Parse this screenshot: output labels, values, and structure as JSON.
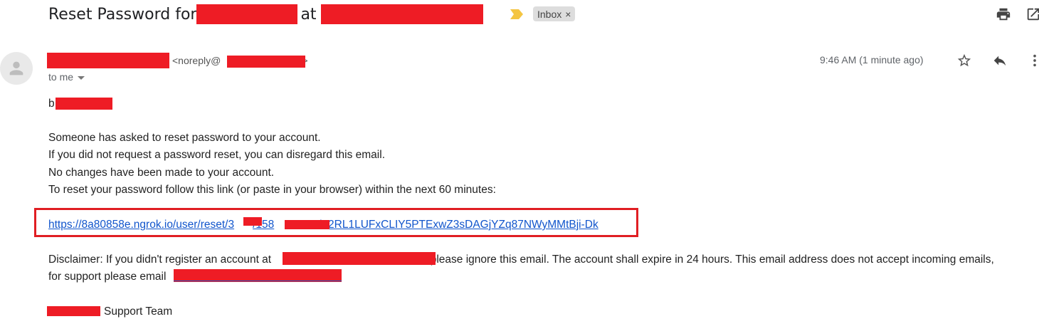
{
  "email": {
    "subject_part1": "Reset Password for",
    "subject_part2": "at",
    "label": "Inbox",
    "label_remove": "×"
  },
  "sender": {
    "email_prefix": "<noreply@",
    "email_suffix": ">",
    "recipient": "to me",
    "timestamp": "9:46 AM (1 minute ago)"
  },
  "body": {
    "greeting": "b",
    "lines": [
      "Someone has asked to reset password to your account.",
      "If you did not request a password reset, you can disregard this email.",
      "No changes have been made to your account.",
      "To reset your password follow this link (or paste in your browser) within the next 60 minutes:"
    ],
    "link": "https://8a80858e.ngrok.io/user/reset/3001/1580000000/F2RL1LUFxCLIY5PTExwZ3sDAGjYZq87NWyMMtBji-Dk",
    "link_visible_start": "https://8a80858e.ngrok.io/user/reset/3",
    "link_visible_mid": "/158",
    "link_visible_end": "/F2RL1LUFxCLIY5PTExwZ3sDAGjYZq87NWyMMtBji-Dk",
    "disclaimer_line1_start": "Disclaimer: If you didn't register an account at",
    "disclaimer_line1_end": ", please ignore this email. The account shall expire in 24 hours. This email address does not accept incoming emails,",
    "disclaimer_line2": "for support please email",
    "signoff": "Support Team"
  },
  "colors": {
    "redaction": "#ee1c25",
    "highlight_box": "#e01e23",
    "link": "#1155cc",
    "label_bg": "#dddddd",
    "importance_marker": "#f4c542"
  },
  "icons": [
    "importance-marker-icon",
    "print-icon",
    "open-in-new-window-icon",
    "avatar-person-icon",
    "star-icon",
    "reply-icon",
    "more-options-icon",
    "dropdown-caret-icon"
  ]
}
